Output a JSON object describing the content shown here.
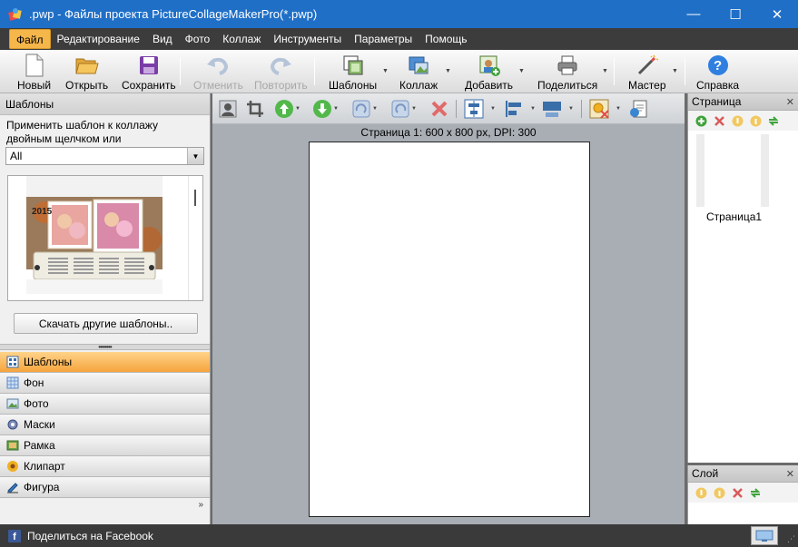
{
  "window": {
    "title": ".pwp - Файлы проекта PictureCollageMakerPro(*.pwp)",
    "minimize_glyph": "—",
    "maximize_glyph": "☐",
    "close_glyph": "✕"
  },
  "menu": {
    "items": [
      "Файл",
      "Редактирование",
      "Вид",
      "Фото",
      "Коллаж",
      "Инструменты",
      "Параметры",
      "Помощь"
    ]
  },
  "toolbar": {
    "new": "Новый",
    "open": "Открыть",
    "save": "Сохранить",
    "undo": "Отменить",
    "redo": "Повторить",
    "templates": "Шаблоны",
    "collage": "Коллаж",
    "add": "Добавить",
    "share": "Поделиться",
    "wizard": "Мастер",
    "help": "Справка",
    "help_glyph": "?"
  },
  "left_panel": {
    "title": "Шаблоны",
    "hint": "Применить шаблон к коллажу двойным щелчком или перетаскиванием",
    "filter_value": "All",
    "template_year": "2015",
    "download_button": "Скачать другие шаблоны..",
    "categories": [
      "Шаблоны",
      "Фон",
      "Фото",
      "Маски",
      "Рамка",
      "Клипарт",
      "Фигура"
    ],
    "more_glyph": "»"
  },
  "canvas": {
    "page_info": "Страница  1: 600 x 800 px, DPI: 300"
  },
  "page_panel": {
    "title": "Страница",
    "page_label": "Страница1",
    "close_glyph": "✕"
  },
  "layer_panel": {
    "title": "Слой",
    "close_glyph": "✕"
  },
  "statusbar": {
    "facebook_label": "Поделиться на Facebook",
    "fb_glyph": "f"
  },
  "colors": {
    "titlebar": "#1f6fc7",
    "menubar": "#3c3c3c",
    "menu_active": "#f5b64a",
    "category_active": "#f6a43c"
  }
}
